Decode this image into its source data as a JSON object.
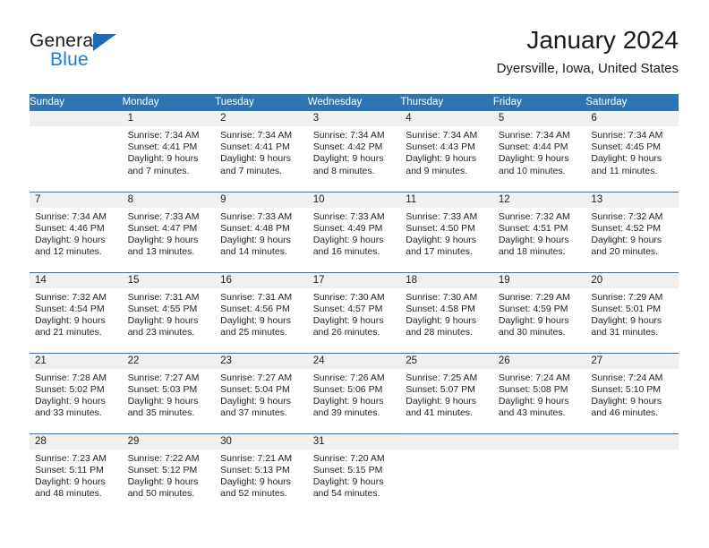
{
  "brand": {
    "name_top": "General",
    "name_bottom": "Blue",
    "accent_color": "#1a7fd4",
    "triangle_color": "#1a6cb5"
  },
  "header": {
    "title": "January 2024",
    "subtitle": "Dyersville, Iowa, United States"
  },
  "calendar": {
    "header_bg": "#2e75b6",
    "daynum_bg": "#f0f0f0",
    "weekday_headers": [
      "Sunday",
      "Monday",
      "Tuesday",
      "Wednesday",
      "Thursday",
      "Friday",
      "Saturday"
    ],
    "weeks": [
      [
        {
          "day": "",
          "sunrise": "",
          "sunset": "",
          "daylight_1": "",
          "daylight_2": ""
        },
        {
          "day": "1",
          "sunrise": "Sunrise: 7:34 AM",
          "sunset": "Sunset: 4:41 PM",
          "daylight_1": "Daylight: 9 hours",
          "daylight_2": "and 7 minutes."
        },
        {
          "day": "2",
          "sunrise": "Sunrise: 7:34 AM",
          "sunset": "Sunset: 4:41 PM",
          "daylight_1": "Daylight: 9 hours",
          "daylight_2": "and 7 minutes."
        },
        {
          "day": "3",
          "sunrise": "Sunrise: 7:34 AM",
          "sunset": "Sunset: 4:42 PM",
          "daylight_1": "Daylight: 9 hours",
          "daylight_2": "and 8 minutes."
        },
        {
          "day": "4",
          "sunrise": "Sunrise: 7:34 AM",
          "sunset": "Sunset: 4:43 PM",
          "daylight_1": "Daylight: 9 hours",
          "daylight_2": "and 9 minutes."
        },
        {
          "day": "5",
          "sunrise": "Sunrise: 7:34 AM",
          "sunset": "Sunset: 4:44 PM",
          "daylight_1": "Daylight: 9 hours",
          "daylight_2": "and 10 minutes."
        },
        {
          "day": "6",
          "sunrise": "Sunrise: 7:34 AM",
          "sunset": "Sunset: 4:45 PM",
          "daylight_1": "Daylight: 9 hours",
          "daylight_2": "and 11 minutes."
        }
      ],
      [
        {
          "day": "7",
          "sunrise": "Sunrise: 7:34 AM",
          "sunset": "Sunset: 4:46 PM",
          "daylight_1": "Daylight: 9 hours",
          "daylight_2": "and 12 minutes."
        },
        {
          "day": "8",
          "sunrise": "Sunrise: 7:33 AM",
          "sunset": "Sunset: 4:47 PM",
          "daylight_1": "Daylight: 9 hours",
          "daylight_2": "and 13 minutes."
        },
        {
          "day": "9",
          "sunrise": "Sunrise: 7:33 AM",
          "sunset": "Sunset: 4:48 PM",
          "daylight_1": "Daylight: 9 hours",
          "daylight_2": "and 14 minutes."
        },
        {
          "day": "10",
          "sunrise": "Sunrise: 7:33 AM",
          "sunset": "Sunset: 4:49 PM",
          "daylight_1": "Daylight: 9 hours",
          "daylight_2": "and 16 minutes."
        },
        {
          "day": "11",
          "sunrise": "Sunrise: 7:33 AM",
          "sunset": "Sunset: 4:50 PM",
          "daylight_1": "Daylight: 9 hours",
          "daylight_2": "and 17 minutes."
        },
        {
          "day": "12",
          "sunrise": "Sunrise: 7:32 AM",
          "sunset": "Sunset: 4:51 PM",
          "daylight_1": "Daylight: 9 hours",
          "daylight_2": "and 18 minutes."
        },
        {
          "day": "13",
          "sunrise": "Sunrise: 7:32 AM",
          "sunset": "Sunset: 4:52 PM",
          "daylight_1": "Daylight: 9 hours",
          "daylight_2": "and 20 minutes."
        }
      ],
      [
        {
          "day": "14",
          "sunrise": "Sunrise: 7:32 AM",
          "sunset": "Sunset: 4:54 PM",
          "daylight_1": "Daylight: 9 hours",
          "daylight_2": "and 21 minutes."
        },
        {
          "day": "15",
          "sunrise": "Sunrise: 7:31 AM",
          "sunset": "Sunset: 4:55 PM",
          "daylight_1": "Daylight: 9 hours",
          "daylight_2": "and 23 minutes."
        },
        {
          "day": "16",
          "sunrise": "Sunrise: 7:31 AM",
          "sunset": "Sunset: 4:56 PM",
          "daylight_1": "Daylight: 9 hours",
          "daylight_2": "and 25 minutes."
        },
        {
          "day": "17",
          "sunrise": "Sunrise: 7:30 AM",
          "sunset": "Sunset: 4:57 PM",
          "daylight_1": "Daylight: 9 hours",
          "daylight_2": "and 26 minutes."
        },
        {
          "day": "18",
          "sunrise": "Sunrise: 7:30 AM",
          "sunset": "Sunset: 4:58 PM",
          "daylight_1": "Daylight: 9 hours",
          "daylight_2": "and 28 minutes."
        },
        {
          "day": "19",
          "sunrise": "Sunrise: 7:29 AM",
          "sunset": "Sunset: 4:59 PM",
          "daylight_1": "Daylight: 9 hours",
          "daylight_2": "and 30 minutes."
        },
        {
          "day": "20",
          "sunrise": "Sunrise: 7:29 AM",
          "sunset": "Sunset: 5:01 PM",
          "daylight_1": "Daylight: 9 hours",
          "daylight_2": "and 31 minutes."
        }
      ],
      [
        {
          "day": "21",
          "sunrise": "Sunrise: 7:28 AM",
          "sunset": "Sunset: 5:02 PM",
          "daylight_1": "Daylight: 9 hours",
          "daylight_2": "and 33 minutes."
        },
        {
          "day": "22",
          "sunrise": "Sunrise: 7:27 AM",
          "sunset": "Sunset: 5:03 PM",
          "daylight_1": "Daylight: 9 hours",
          "daylight_2": "and 35 minutes."
        },
        {
          "day": "23",
          "sunrise": "Sunrise: 7:27 AM",
          "sunset": "Sunset: 5:04 PM",
          "daylight_1": "Daylight: 9 hours",
          "daylight_2": "and 37 minutes."
        },
        {
          "day": "24",
          "sunrise": "Sunrise: 7:26 AM",
          "sunset": "Sunset: 5:06 PM",
          "daylight_1": "Daylight: 9 hours",
          "daylight_2": "and 39 minutes."
        },
        {
          "day": "25",
          "sunrise": "Sunrise: 7:25 AM",
          "sunset": "Sunset: 5:07 PM",
          "daylight_1": "Daylight: 9 hours",
          "daylight_2": "and 41 minutes."
        },
        {
          "day": "26",
          "sunrise": "Sunrise: 7:24 AM",
          "sunset": "Sunset: 5:08 PM",
          "daylight_1": "Daylight: 9 hours",
          "daylight_2": "and 43 minutes."
        },
        {
          "day": "27",
          "sunrise": "Sunrise: 7:24 AM",
          "sunset": "Sunset: 5:10 PM",
          "daylight_1": "Daylight: 9 hours",
          "daylight_2": "and 46 minutes."
        }
      ],
      [
        {
          "day": "28",
          "sunrise": "Sunrise: 7:23 AM",
          "sunset": "Sunset: 5:11 PM",
          "daylight_1": "Daylight: 9 hours",
          "daylight_2": "and 48 minutes."
        },
        {
          "day": "29",
          "sunrise": "Sunrise: 7:22 AM",
          "sunset": "Sunset: 5:12 PM",
          "daylight_1": "Daylight: 9 hours",
          "daylight_2": "and 50 minutes."
        },
        {
          "day": "30",
          "sunrise": "Sunrise: 7:21 AM",
          "sunset": "Sunset: 5:13 PM",
          "daylight_1": "Daylight: 9 hours",
          "daylight_2": "and 52 minutes."
        },
        {
          "day": "31",
          "sunrise": "Sunrise: 7:20 AM",
          "sunset": "Sunset: 5:15 PM",
          "daylight_1": "Daylight: 9 hours",
          "daylight_2": "and 54 minutes."
        },
        {
          "day": "",
          "sunrise": "",
          "sunset": "",
          "daylight_1": "",
          "daylight_2": ""
        },
        {
          "day": "",
          "sunrise": "",
          "sunset": "",
          "daylight_1": "",
          "daylight_2": ""
        },
        {
          "day": "",
          "sunrise": "",
          "sunset": "",
          "daylight_1": "",
          "daylight_2": ""
        }
      ]
    ]
  }
}
